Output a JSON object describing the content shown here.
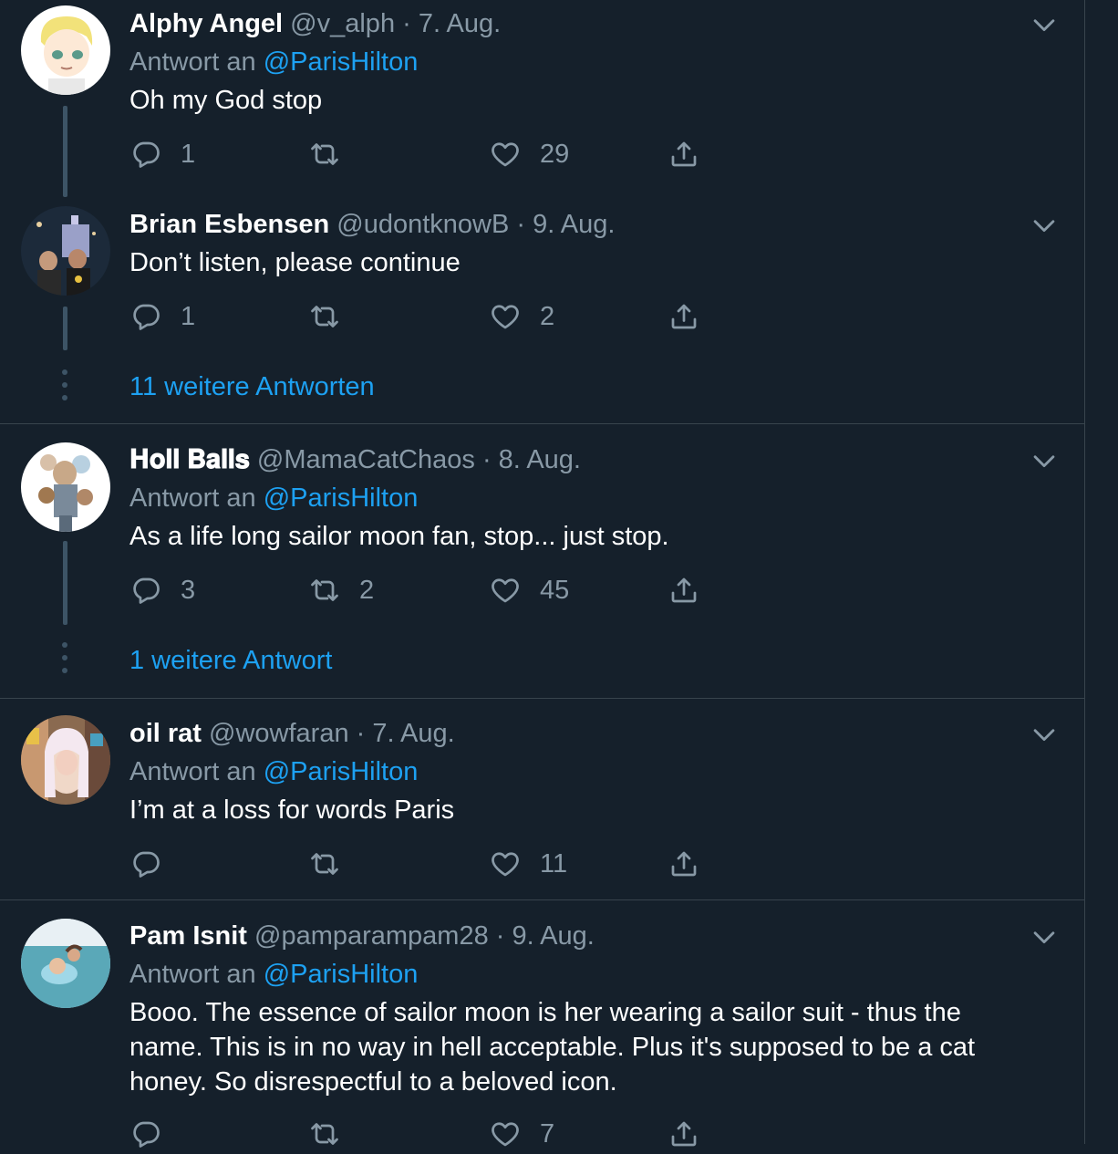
{
  "tweets": [
    {
      "name": "Alphy Angel",
      "handle": "@v_alph",
      "sep": " · ",
      "date": "7. Aug.",
      "reply_prefix": "Antwort an ",
      "reply_to": "@ParisHilton",
      "text": "Oh my God stop",
      "reply_count": "1",
      "retweet_count": "",
      "like_count": "29"
    },
    {
      "name": "Brian Esbensen",
      "handle": "@udontknowB",
      "sep": " · ",
      "date": "9. Aug.",
      "text": "Don’t listen, please continue",
      "reply_count": "1",
      "retweet_count": "",
      "like_count": "2",
      "more_replies": "11 weitere Antworten"
    },
    {
      "name": "𝐇𝐨𝐥𝐥 𝐁𝐚𝐥𝐥𝐬",
      "handle": "@MamaCatChaos",
      "sep": " · ",
      "date": "8. Aug.",
      "reply_prefix": "Antwort an ",
      "reply_to": "@ParisHilton",
      "text": "As a life long sailor moon fan, stop... just stop.",
      "reply_count": "3",
      "retweet_count": "2",
      "like_count": "45",
      "more_replies": "1 weitere Antwort"
    },
    {
      "name": "oil rat",
      "handle": "@wowfaran",
      "sep": " · ",
      "date": "7. Aug.",
      "reply_prefix": "Antwort an ",
      "reply_to": "@ParisHilton",
      "text": "I’m at a loss for words Paris",
      "reply_count": "",
      "retweet_count": "",
      "like_count": "11"
    },
    {
      "name": "Pam Isnit",
      "handle": "@pamparampam28",
      "sep": " · ",
      "date": "9. Aug.",
      "reply_prefix": "Antwort an ",
      "reply_to": "@ParisHilton",
      "text": "Booo. The essence of sailor moon is her wearing a sailor suit - thus the name. This is in no way in hell acceptable. Plus it's supposed to be a cat honey. So disrespectful to a beloved icon.",
      "reply_count": "",
      "retweet_count": "",
      "like_count": "7"
    }
  ],
  "icons": {
    "reply": "reply-icon",
    "retweet": "retweet-icon",
    "like": "heart-icon",
    "share": "share-icon",
    "menu": "chevron-down-icon"
  },
  "colors": {
    "background": "#15202b",
    "secondary_text": "#8899a6",
    "link": "#1da1f2",
    "thread_line": "#3d5466",
    "divider": "#38444d"
  }
}
